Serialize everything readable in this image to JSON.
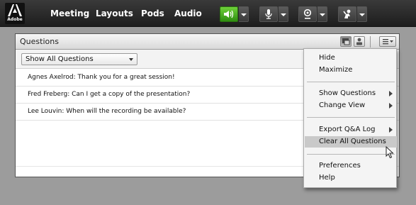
{
  "brand": {
    "logo_text": "Adobe"
  },
  "menubar": {
    "items": [
      {
        "label": "Meeting"
      },
      {
        "label": "Layouts"
      },
      {
        "label": "Pods"
      },
      {
        "label": "Audio"
      }
    ]
  },
  "toolbar": {
    "icons": [
      "speaker-icon",
      "microphone-icon",
      "webcam-icon",
      "raise-hand-icon"
    ],
    "active_color": "#3fb31f"
  },
  "pod": {
    "title": "Questions",
    "filter": {
      "selected": "Show All Questions"
    },
    "questions": [
      {
        "text": "Agnes Axelrod: Thank you for a great session!"
      },
      {
        "text": "Fred Freberg: Can I get a copy of the presentation?"
      },
      {
        "text": "Lee Louvin: When will the recording be available?"
      }
    ]
  },
  "context_menu": {
    "groups": [
      [
        {
          "label": "Hide"
        },
        {
          "label": "Maximize"
        }
      ],
      [
        {
          "label": "Show Questions",
          "submenu": true
        },
        {
          "label": "Change View",
          "submenu": true
        }
      ],
      [
        {
          "label": "Export Q&A Log",
          "submenu": true
        },
        {
          "label": "Clear All Questions",
          "highlighted": true
        }
      ],
      [
        {
          "label": "Preferences"
        },
        {
          "label": "Help"
        }
      ]
    ]
  }
}
